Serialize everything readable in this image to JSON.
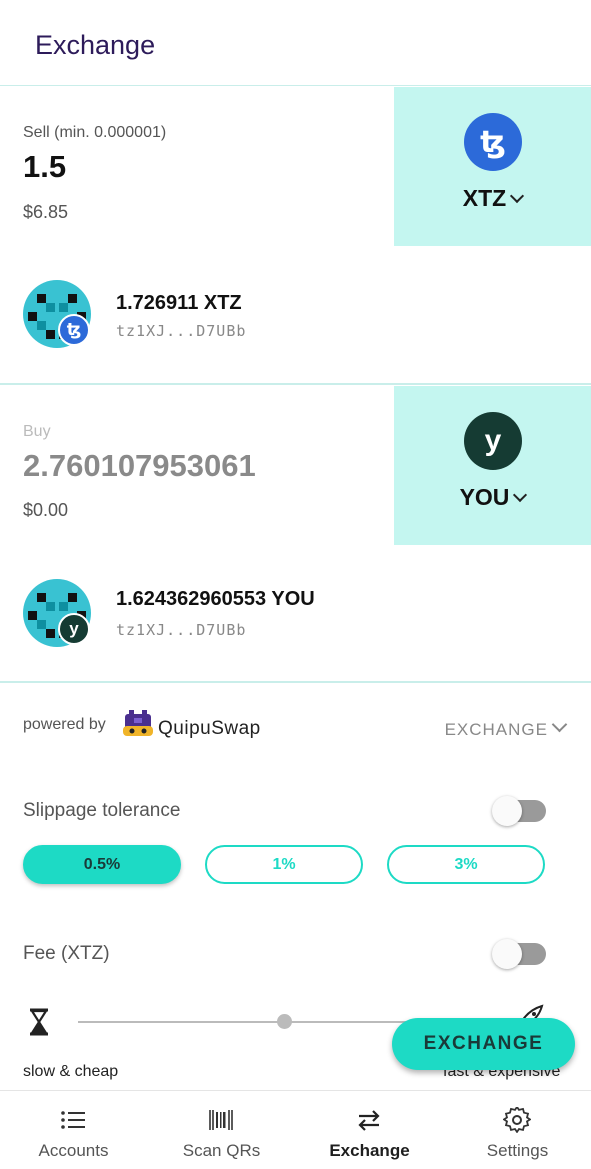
{
  "header": {
    "title": "Exchange"
  },
  "sell": {
    "label": "Sell (min. 0.000001)",
    "amount": "1.5",
    "usd": "$6.85",
    "token": {
      "symbol": "XTZ",
      "icon": "tezos-icon",
      "glyph": "ꜩ",
      "color": "#2c6ad9"
    },
    "account": {
      "balance": "1.726911 XTZ",
      "address": "tz1XJ...D7UBb"
    }
  },
  "buy": {
    "label": "Buy",
    "amount": "2.760107953061",
    "usd": "$0.00",
    "token": {
      "symbol": "YOU",
      "icon": "you-token-icon",
      "glyph": "y",
      "color": "#153b33"
    },
    "account": {
      "balance": "1.624362960553 YOU",
      "address": "tz1XJ...D7UBb"
    }
  },
  "provider": {
    "powered_by": "powered by",
    "name": "QuipuSwap",
    "mode": "EXCHANGE"
  },
  "slippage": {
    "label": "Slippage tolerance",
    "options": [
      "0.5%",
      "1%",
      "3%"
    ],
    "selected": "0.5%",
    "toggle_on": false
  },
  "fee": {
    "label": "Fee (XTZ)",
    "toggle_on": false,
    "slow_label": "slow & cheap",
    "fast_label": "fast & expensive",
    "level": 0.47
  },
  "action": {
    "exchange_label": "EXCHANGE"
  },
  "nav": {
    "items": [
      {
        "label": "Accounts",
        "icon": "list-icon"
      },
      {
        "label": "Scan QRs",
        "icon": "barcode-scan-icon"
      },
      {
        "label": "Exchange",
        "icon": "swap-arrows-icon"
      },
      {
        "label": "Settings",
        "icon": "gear-icon"
      }
    ],
    "active": "Exchange"
  },
  "colors": {
    "accent": "#1ddac5",
    "token_box": "#c4f6f0",
    "title": "#2d1b5a"
  }
}
